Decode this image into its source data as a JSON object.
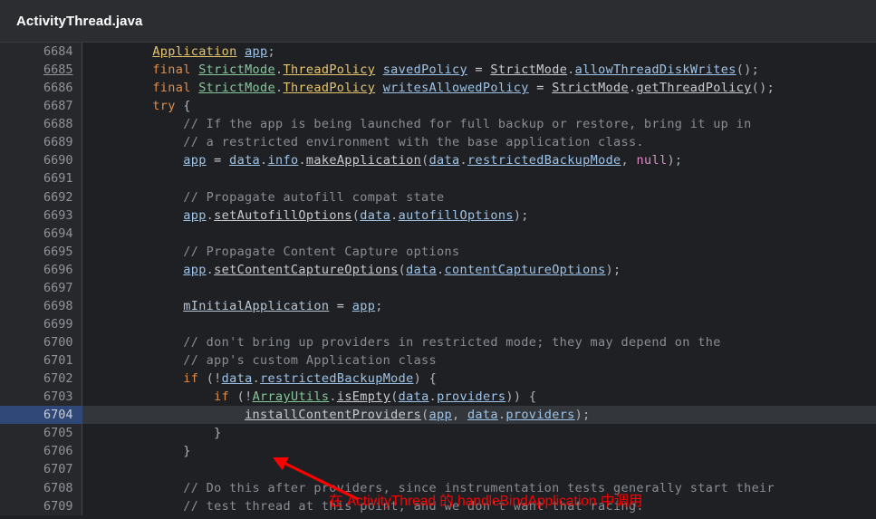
{
  "header": {
    "file_title": "ActivityThread.java"
  },
  "editor": {
    "first_line_number": 6684,
    "current_line_number": 6704,
    "underlined_line_number": 6685,
    "colors": {
      "background": "#1e2024",
      "gutter_background": "#26282c",
      "gutter_text": "#919499",
      "current_line_gutter": "#2f4878",
      "current_line_background": "#33363b",
      "header_background": "#2b2d30",
      "comment": "#8a8e94",
      "keyword": "#e08d4a",
      "type": "#e6c56c",
      "class": "#86c79a",
      "field": "#9fc4e8",
      "local": "#b9c6d4",
      "null_literal": "#e08ac4",
      "annotation": "#ff0000"
    },
    "lines": [
      {
        "n": 6684,
        "tokens": [
          {
            "t": "plain",
            "s": "        "
          },
          {
            "t": "type",
            "s": "Application"
          },
          {
            "t": "plain",
            "s": " "
          },
          {
            "t": "field",
            "s": "app"
          },
          {
            "t": "punct",
            "s": ";"
          }
        ]
      },
      {
        "n": 6685,
        "underline_number": true,
        "tokens": [
          {
            "t": "plain",
            "s": "        "
          },
          {
            "t": "keyword",
            "s": "final"
          },
          {
            "t": "plain",
            "s": " "
          },
          {
            "t": "class",
            "s": "StrictMode"
          },
          {
            "t": "punct",
            "s": "."
          },
          {
            "t": "type",
            "s": "ThreadPolicy"
          },
          {
            "t": "plain",
            "s": " "
          },
          {
            "t": "field",
            "s": "savedPolicy"
          },
          {
            "t": "plain",
            "s": " = "
          },
          {
            "t": "method",
            "s": "StrictMode"
          },
          {
            "t": "punct",
            "s": "."
          },
          {
            "t": "field",
            "s": "allowThreadDiskWrites"
          },
          {
            "t": "punct",
            "s": "();"
          }
        ]
      },
      {
        "n": 6686,
        "tokens": [
          {
            "t": "plain",
            "s": "        "
          },
          {
            "t": "keyword",
            "s": "final"
          },
          {
            "t": "plain",
            "s": " "
          },
          {
            "t": "class",
            "s": "StrictMode"
          },
          {
            "t": "punct",
            "s": "."
          },
          {
            "t": "type",
            "s": "ThreadPolicy"
          },
          {
            "t": "plain",
            "s": " "
          },
          {
            "t": "field",
            "s": "writesAllowedPolicy"
          },
          {
            "t": "plain",
            "s": " = "
          },
          {
            "t": "method",
            "s": "StrictMode"
          },
          {
            "t": "punct",
            "s": "."
          },
          {
            "t": "method",
            "s": "getThreadPolicy"
          },
          {
            "t": "punct",
            "s": "();"
          }
        ]
      },
      {
        "n": 6687,
        "tokens": [
          {
            "t": "plain",
            "s": "        "
          },
          {
            "t": "keyword",
            "s": "try"
          },
          {
            "t": "plain",
            "s": " "
          },
          {
            "t": "punct",
            "s": "{"
          }
        ]
      },
      {
        "n": 6688,
        "tokens": [
          {
            "t": "plain",
            "s": "            "
          },
          {
            "t": "comment",
            "s": "// If the app is being launched for full backup or restore, bring it up in"
          }
        ]
      },
      {
        "n": 6689,
        "tokens": [
          {
            "t": "plain",
            "s": "            "
          },
          {
            "t": "comment",
            "s": "// a restricted environment with the base application class."
          }
        ]
      },
      {
        "n": 6690,
        "tokens": [
          {
            "t": "plain",
            "s": "            "
          },
          {
            "t": "field",
            "s": "app"
          },
          {
            "t": "plain",
            "s": " = "
          },
          {
            "t": "field",
            "s": "data"
          },
          {
            "t": "punct",
            "s": "."
          },
          {
            "t": "field",
            "s": "info"
          },
          {
            "t": "punct",
            "s": "."
          },
          {
            "t": "method",
            "s": "makeApplication"
          },
          {
            "t": "punct",
            "s": "("
          },
          {
            "t": "field",
            "s": "data"
          },
          {
            "t": "punct",
            "s": "."
          },
          {
            "t": "field",
            "s": "restrictedBackupMode"
          },
          {
            "t": "punct",
            "s": ", "
          },
          {
            "t": "null",
            "s": "null"
          },
          {
            "t": "punct",
            "s": ");"
          }
        ]
      },
      {
        "n": 6691,
        "tokens": []
      },
      {
        "n": 6692,
        "tokens": [
          {
            "t": "plain",
            "s": "            "
          },
          {
            "t": "comment",
            "s": "// Propagate autofill compat state"
          }
        ]
      },
      {
        "n": 6693,
        "tokens": [
          {
            "t": "plain",
            "s": "            "
          },
          {
            "t": "field",
            "s": "app"
          },
          {
            "t": "punct",
            "s": "."
          },
          {
            "t": "method",
            "s": "setAutofillOptions"
          },
          {
            "t": "punct",
            "s": "("
          },
          {
            "t": "field",
            "s": "data"
          },
          {
            "t": "punct",
            "s": "."
          },
          {
            "t": "field",
            "s": "autofillOptions"
          },
          {
            "t": "punct",
            "s": ");"
          }
        ]
      },
      {
        "n": 6694,
        "tokens": []
      },
      {
        "n": 6695,
        "tokens": [
          {
            "t": "plain",
            "s": "            "
          },
          {
            "t": "comment",
            "s": "// Propagate Content Capture options"
          }
        ]
      },
      {
        "n": 6696,
        "tokens": [
          {
            "t": "plain",
            "s": "            "
          },
          {
            "t": "field",
            "s": "app"
          },
          {
            "t": "punct",
            "s": "."
          },
          {
            "t": "method",
            "s": "setContentCaptureOptions"
          },
          {
            "t": "punct",
            "s": "("
          },
          {
            "t": "field",
            "s": "data"
          },
          {
            "t": "punct",
            "s": "."
          },
          {
            "t": "field",
            "s": "contentCaptureOptions"
          },
          {
            "t": "punct",
            "s": ");"
          }
        ]
      },
      {
        "n": 6697,
        "tokens": []
      },
      {
        "n": 6698,
        "tokens": [
          {
            "t": "plain",
            "s": "            "
          },
          {
            "t": "local",
            "s": "mInitialApplication"
          },
          {
            "t": "plain",
            "s": " = "
          },
          {
            "t": "field",
            "s": "app"
          },
          {
            "t": "punct",
            "s": ";"
          }
        ]
      },
      {
        "n": 6699,
        "tokens": []
      },
      {
        "n": 6700,
        "tokens": [
          {
            "t": "plain",
            "s": "            "
          },
          {
            "t": "comment",
            "s": "// don't bring up providers in restricted mode; they may depend on the"
          }
        ]
      },
      {
        "n": 6701,
        "tokens": [
          {
            "t": "plain",
            "s": "            "
          },
          {
            "t": "comment",
            "s": "// app's custom Application class"
          }
        ]
      },
      {
        "n": 6702,
        "tokens": [
          {
            "t": "plain",
            "s": "            "
          },
          {
            "t": "keyword",
            "s": "if"
          },
          {
            "t": "plain",
            "s": " "
          },
          {
            "t": "punct",
            "s": "(!"
          },
          {
            "t": "field",
            "s": "data"
          },
          {
            "t": "punct",
            "s": "."
          },
          {
            "t": "field",
            "s": "restrictedBackupMode"
          },
          {
            "t": "punct",
            "s": ") {"
          }
        ]
      },
      {
        "n": 6703,
        "tokens": [
          {
            "t": "plain",
            "s": "                "
          },
          {
            "t": "keyword",
            "s": "if"
          },
          {
            "t": "plain",
            "s": " "
          },
          {
            "t": "punct",
            "s": "(!"
          },
          {
            "t": "class",
            "s": "ArrayUtils"
          },
          {
            "t": "punct",
            "s": "."
          },
          {
            "t": "method",
            "s": "isEmpty"
          },
          {
            "t": "punct",
            "s": "("
          },
          {
            "t": "field",
            "s": "data"
          },
          {
            "t": "punct",
            "s": "."
          },
          {
            "t": "field",
            "s": "providers"
          },
          {
            "t": "punct",
            "s": ")) {"
          }
        ]
      },
      {
        "n": 6704,
        "current": true,
        "tokens": [
          {
            "t": "plain",
            "s": "                    "
          },
          {
            "t": "method",
            "s": "installContentProviders"
          },
          {
            "t": "punct",
            "s": "("
          },
          {
            "t": "field",
            "s": "app"
          },
          {
            "t": "punct",
            "s": ", "
          },
          {
            "t": "field",
            "s": "data"
          },
          {
            "t": "punct",
            "s": "."
          },
          {
            "t": "field",
            "s": "providers"
          },
          {
            "t": "punct",
            "s": ");"
          }
        ]
      },
      {
        "n": 6705,
        "tokens": [
          {
            "t": "plain",
            "s": "                "
          },
          {
            "t": "punct",
            "s": "}"
          }
        ]
      },
      {
        "n": 6706,
        "tokens": [
          {
            "t": "plain",
            "s": "            "
          },
          {
            "t": "punct",
            "s": "}"
          }
        ]
      },
      {
        "n": 6707,
        "tokens": []
      },
      {
        "n": 6708,
        "tokens": [
          {
            "t": "plain",
            "s": "            "
          },
          {
            "t": "comment",
            "s": "// Do this after providers, since instrumentation tests generally start their"
          }
        ]
      },
      {
        "n": 6709,
        "tokens": [
          {
            "t": "plain",
            "s": "            "
          },
          {
            "t": "comment",
            "s": "// test thread at this point, and we don't want that racing."
          }
        ]
      }
    ]
  },
  "annotation": {
    "text": "在 ActivityThread 的 handleBindApplication 中调用",
    "color": "#ff0000"
  }
}
